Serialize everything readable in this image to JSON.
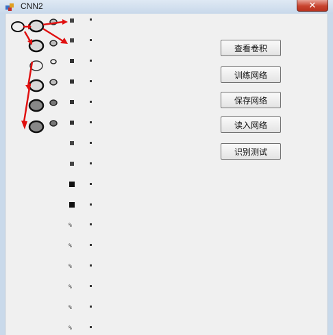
{
  "window": {
    "title": "CNN2",
    "close_label": "✕"
  },
  "buttons": {
    "view_kernel": "查看卷积",
    "train_net": "训练网络",
    "save_net": "保存网络",
    "load_net": "读入网络",
    "recognize": "识别测试"
  },
  "colors": {
    "arrow": "#e01010",
    "client_bg": "#f0f0f0",
    "frame": "#c9d9ea"
  },
  "icons": {
    "app": "app-icon",
    "close": "close-icon"
  }
}
